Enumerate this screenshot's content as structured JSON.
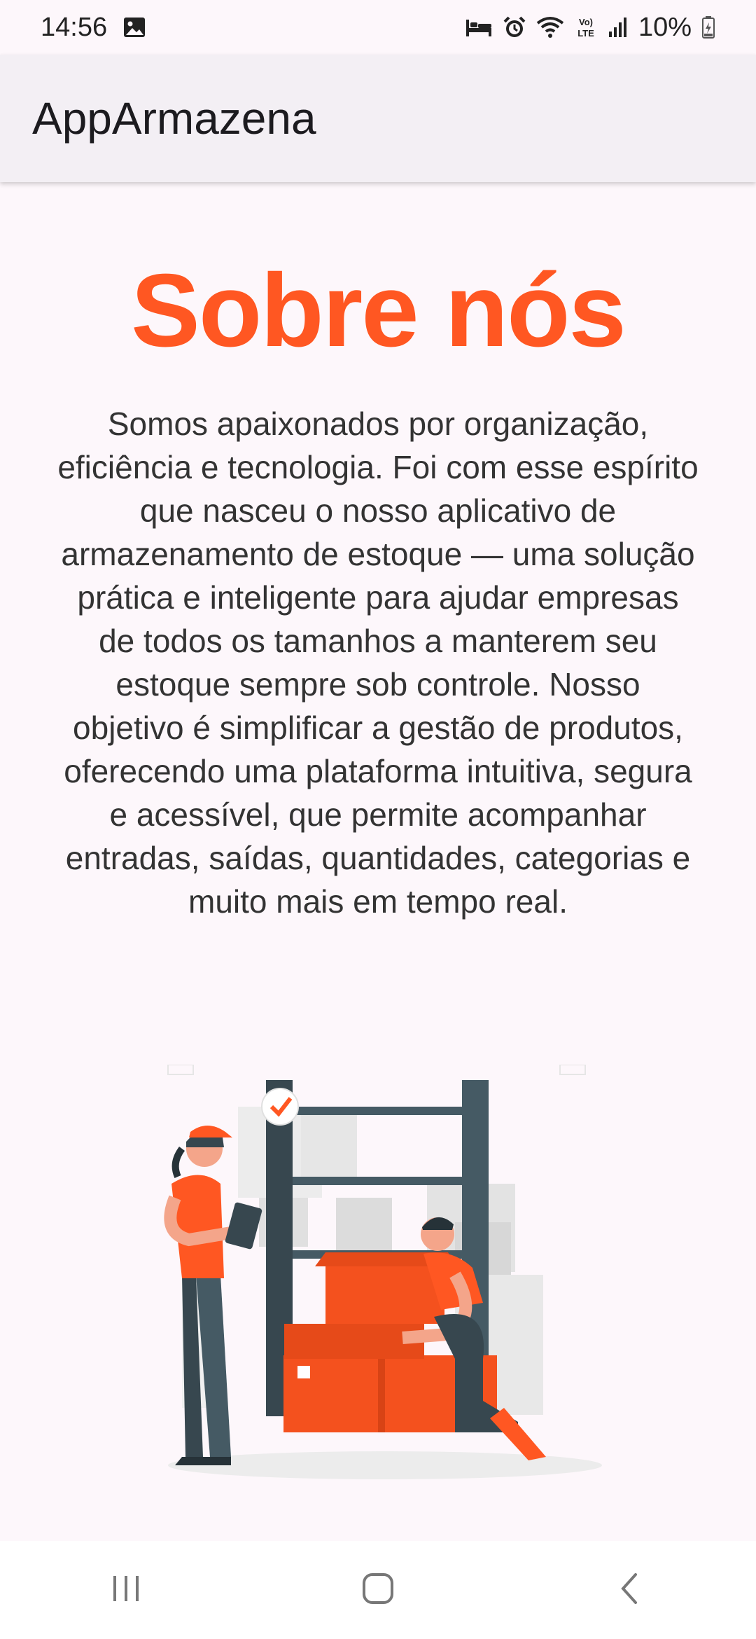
{
  "status_bar": {
    "time": "14:56",
    "battery": "10%",
    "icons": [
      "image-icon",
      "bed-icon",
      "alarm-icon",
      "wifi-icon",
      "volte-icon",
      "signal-icon",
      "battery-icon"
    ]
  },
  "app_bar": {
    "title": "AppArmazena"
  },
  "about": {
    "heading": "Sobre nós",
    "body": "Somos apaixonados por organização, eficiência e tecnologia. Foi com esse espírito que nasceu o nosso aplicativo de armazenamento de estoque — uma solução prática e inteligente para ajudar empresas de todos os tamanhos a manterem seu estoque sempre sob controle.  Nosso objetivo é simplificar a gestão de produtos, oferecendo uma plataforma intuitiva, segura e acessível, que permite acompanhar entradas, saídas, quantidades, categorias e muito mais em tempo real."
  },
  "colors": {
    "accent": "#ff5722",
    "background": "#fdf7fb",
    "app_bar": "#f3eff4"
  },
  "nav_bar": {
    "icons": [
      "recent-apps-icon",
      "home-icon",
      "back-icon"
    ]
  }
}
